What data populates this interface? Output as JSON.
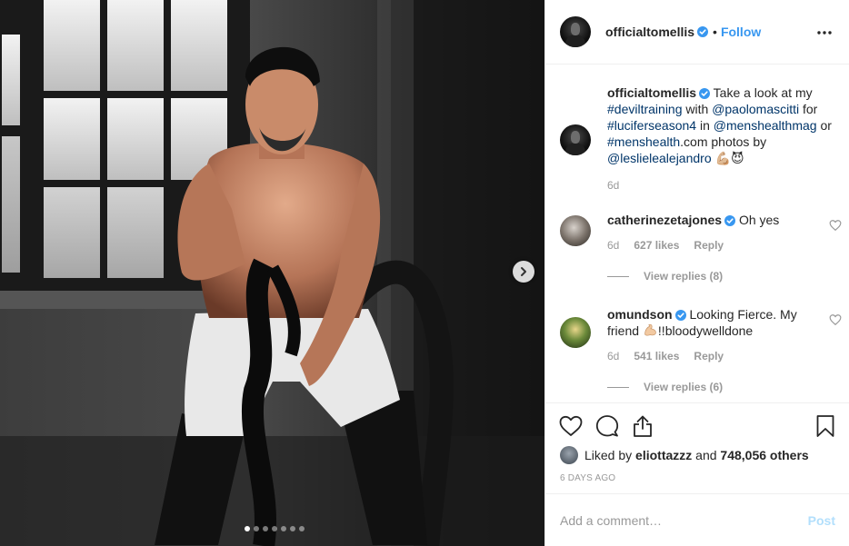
{
  "post": {
    "owner_username": "officialtomellis",
    "follow_label": "Follow",
    "bullet": "•",
    "slides_total": 7,
    "slide_active": 1
  },
  "caption": {
    "username": "officialtomellis",
    "parts": [
      {
        "text": " Take a look at my ",
        "tag": false
      },
      {
        "text": "#deviltraining",
        "tag": true
      },
      {
        "text": " with ",
        "tag": false
      },
      {
        "text": "@paolomascitti",
        "tag": true
      },
      {
        "text": " for ",
        "tag": false
      },
      {
        "text": "#luciferseason4",
        "tag": true
      },
      {
        "text": " in ",
        "tag": false
      },
      {
        "text": "@menshealthmag",
        "tag": true
      },
      {
        "text": " or ",
        "tag": false
      },
      {
        "text": "#menshealth",
        "tag": true
      },
      {
        "text": ".com photos by ",
        "tag": false
      },
      {
        "text": "@leslielealejandro",
        "tag": true
      },
      {
        "text": " 💪🏼😈",
        "tag": false
      }
    ],
    "time": "6d"
  },
  "comments": [
    {
      "username": "catherinezetajones",
      "text": "Oh yes",
      "time": "6d",
      "likes": "627 likes",
      "reply_label": "Reply",
      "view_replies": "View replies (8)"
    },
    {
      "username": "omundson",
      "text_before": "Looking Fierce. My friend ",
      "text_after": "!!bloodywelldone",
      "time": "6d",
      "likes": "541 likes",
      "reply_label": "Reply",
      "view_replies": "View replies (6)"
    }
  ],
  "engagement": {
    "liked_by_prefix": "Liked by ",
    "liked_by_user": "eliottazzz",
    "liked_by_and": " and ",
    "others_count": "748,056 others",
    "timestamp": "6 DAYS AGO"
  },
  "comment_box": {
    "placeholder": "Add a comment…",
    "post_label": "Post"
  },
  "colors": {
    "link": "#003569",
    "follow": "#3897f0",
    "verified": "#3897f0",
    "post_disabled": "#b2dffc"
  }
}
